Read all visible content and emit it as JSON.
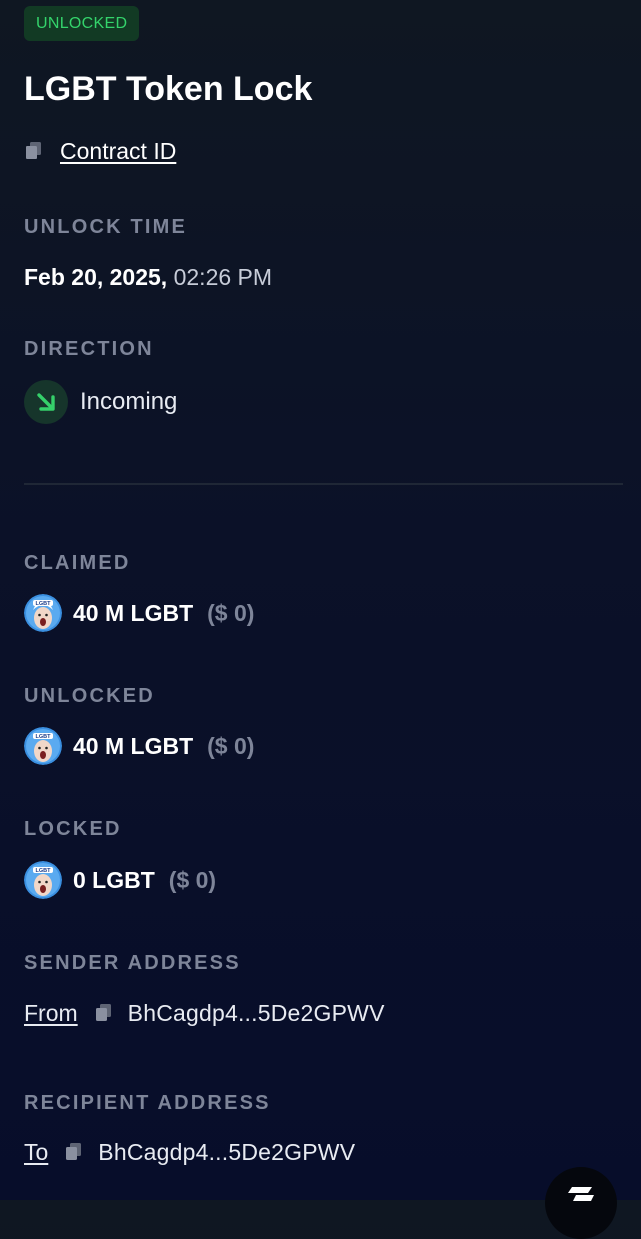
{
  "badge": {
    "label": "UNLOCKED"
  },
  "title": "LGBT Token Lock",
  "contract": {
    "link_label": "Contract ID",
    "copy_icon": "copy-icon"
  },
  "unlock_time": {
    "label": "UNLOCK TIME",
    "date": "Feb 20, 2025,",
    "time": "02:26 PM"
  },
  "direction": {
    "label": "DIRECTION",
    "value": "Incoming",
    "icon": "arrow-down-right-icon"
  },
  "claimed": {
    "label": "CLAIMED",
    "amount": "40 M LGBT",
    "usd": "($ 0)"
  },
  "unlocked": {
    "label": "UNLOCKED",
    "amount": "40 M LGBT",
    "usd": "($ 0)"
  },
  "locked": {
    "label": "LOCKED",
    "amount": "0 LGBT",
    "usd": "($ 0)"
  },
  "sender": {
    "label": "SENDER ADDRESS",
    "prefix": "From",
    "address": "BhCagdp4...5De2GPWV"
  },
  "recipient": {
    "label": "RECIPIENT ADDRESS",
    "prefix": "To",
    "address": "BhCagdp4...5De2GPWV"
  },
  "colors": {
    "accent_green": "#34d36b",
    "badge_bg": "#123a24",
    "muted_label": "#7e8599",
    "background": "#0b1128"
  }
}
